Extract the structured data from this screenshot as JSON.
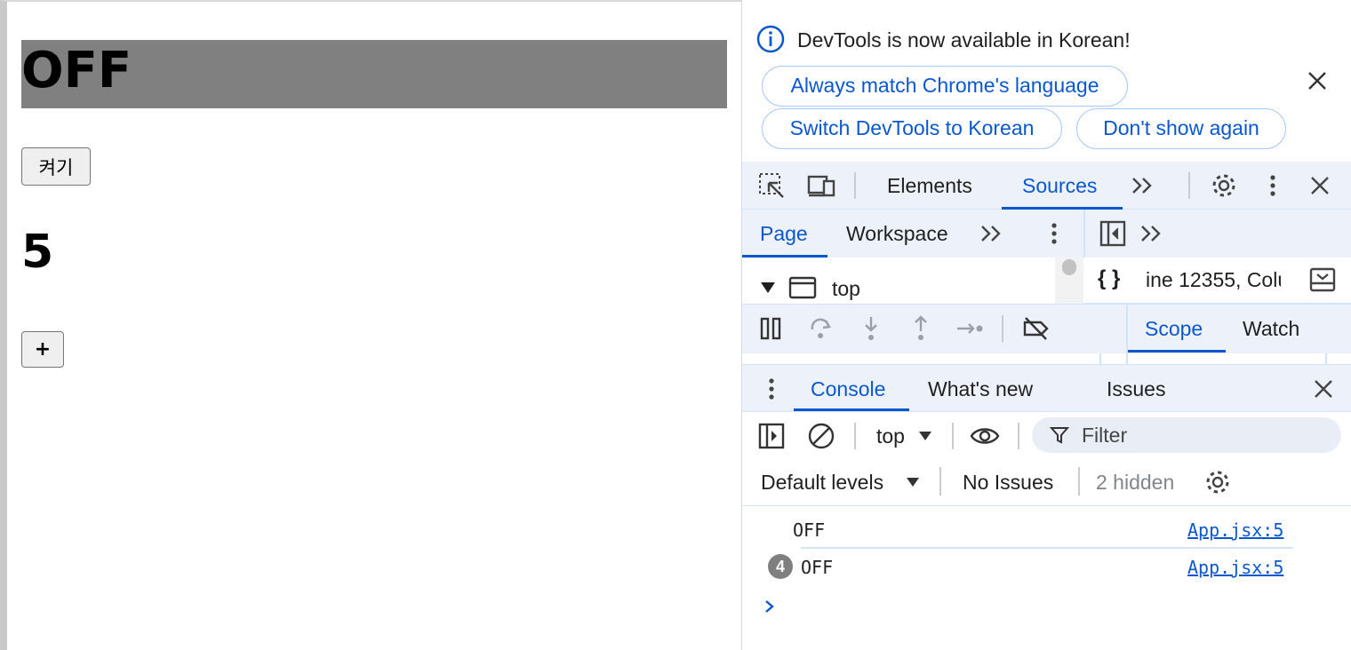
{
  "app": {
    "status_text": "OFF",
    "toggle_button_label": "켜기",
    "count": "5",
    "plus_button_label": "+"
  },
  "devtools": {
    "infobar": {
      "message": "DevTools is now available in Korean!",
      "always_match": "Always match Chrome's language",
      "switch_korean": "Switch DevTools to Korean",
      "dont_show": "Don't show again"
    },
    "main_tabs": {
      "elements": "Elements",
      "sources": "Sources",
      "active": "Sources"
    },
    "sources": {
      "page_tab": "Page",
      "workspace_tab": "Workspace",
      "tree_top": "top",
      "editor_location": "ine 12355, Colu",
      "scope_tab": "Scope",
      "watch_tab": "Watch"
    },
    "drawer_tabs": {
      "console": "Console",
      "whats_new": "What's new",
      "issues": "Issues"
    },
    "console_toolbar": {
      "context": "top",
      "filter_placeholder": "Filter",
      "default_levels": "Default levels",
      "no_issues": "No Issues",
      "hidden": "2 hidden"
    },
    "logs": [
      {
        "text": "OFF",
        "source": "App.jsx:5",
        "repeat": ""
      },
      {
        "text": "OFF",
        "source": "App.jsx:5",
        "repeat": "4"
      }
    ]
  },
  "colors": {
    "accent": "#0b57d0",
    "heading_bg": "#808080",
    "toolbar_bg": "#edf2fa"
  }
}
